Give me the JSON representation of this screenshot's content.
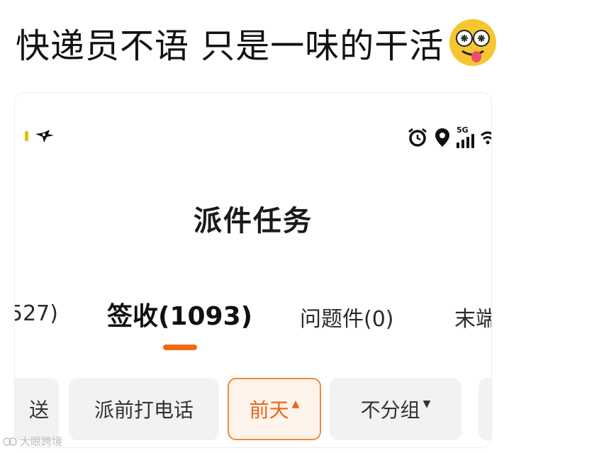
{
  "caption": {
    "text": "快递员不语 只是一味的干活",
    "emoji_icon": "drooling-emoji-icon"
  },
  "phone": {
    "status_bar": {
      "network_label": "5G",
      "left_icons": [
        "notification-dot-icon",
        "bird-icon"
      ],
      "right_icons": [
        "alarm-icon",
        "location-icon",
        "signal-icon",
        "wifi-icon"
      ]
    },
    "title": "派件任务",
    "tabs": [
      {
        "label": "527)"
      },
      {
        "label": "签收(1093)",
        "active": true
      },
      {
        "label": "问题件(0)"
      },
      {
        "label": "末端"
      }
    ],
    "filters": [
      {
        "label": "送"
      },
      {
        "label": "派前打电话"
      },
      {
        "label": "前天",
        "caret": "▲",
        "selected": true
      },
      {
        "label": "不分组",
        "caret": "▼"
      },
      {
        "label": ""
      }
    ]
  },
  "watermark": {
    "text": "大眼跨境"
  },
  "colors": {
    "accent": "#f06a14",
    "selected_bg": "#fff4ec",
    "chip_bg": "#f2f2f2",
    "emoji_face": "#f7c531"
  }
}
